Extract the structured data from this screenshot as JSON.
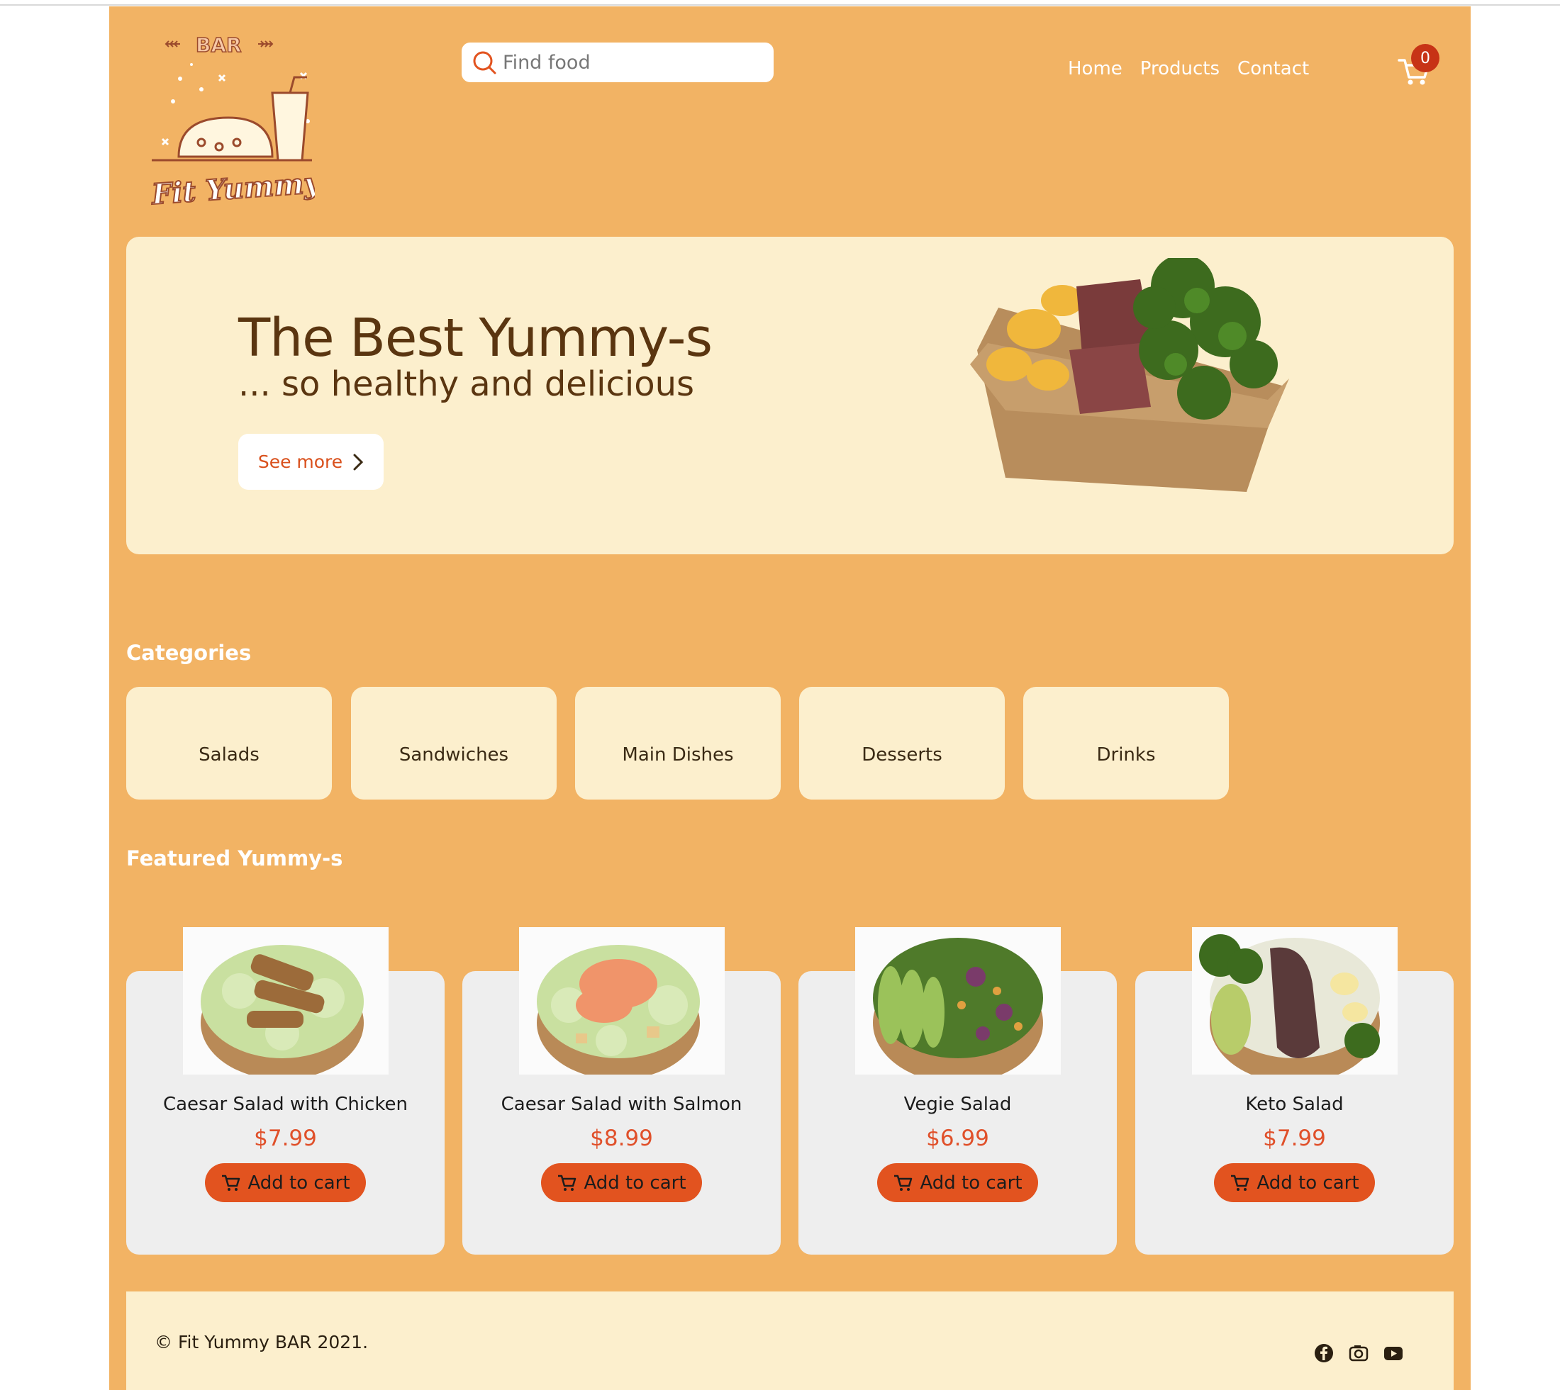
{
  "logo": {
    "top_text": "BAR",
    "bottom_text": "Fit Yummy"
  },
  "search": {
    "placeholder": "Find food"
  },
  "nav": {
    "home": "Home",
    "products": "Products",
    "contact": "Contact"
  },
  "cart": {
    "count": "0"
  },
  "hero": {
    "title": "The Best Yummy-s",
    "subtitle": "... so healthy and delicious",
    "button": "See more"
  },
  "categories": {
    "heading": "Categories",
    "items": [
      "Salads",
      "Sandwiches",
      "Main Dishes",
      "Desserts",
      "Drinks"
    ]
  },
  "featured": {
    "heading": "Featured Yummy-s",
    "products": [
      {
        "name": "Caesar Salad with Chicken",
        "price": "$7.99",
        "button": "Add to cart"
      },
      {
        "name": "Caesar Salad with Salmon",
        "price": "$8.99",
        "button": "Add to cart"
      },
      {
        "name": "Vegie Salad",
        "price": "$6.99",
        "button": "Add to cart"
      },
      {
        "name": "Keto Salad",
        "price": "$7.99",
        "button": "Add to cart"
      }
    ]
  },
  "footer": {
    "copyright": "© Fit Yummy BAR 2021.",
    "social_icons": [
      "facebook-icon",
      "instagram-icon",
      "youtube-icon"
    ]
  },
  "colors": {
    "page_bg": "#f2b364",
    "panel_bg": "#fcefcd",
    "card_bg": "#eeeeee",
    "accent": "#e2531f",
    "badge": "#c73316",
    "heading_text": "#5a3510"
  }
}
